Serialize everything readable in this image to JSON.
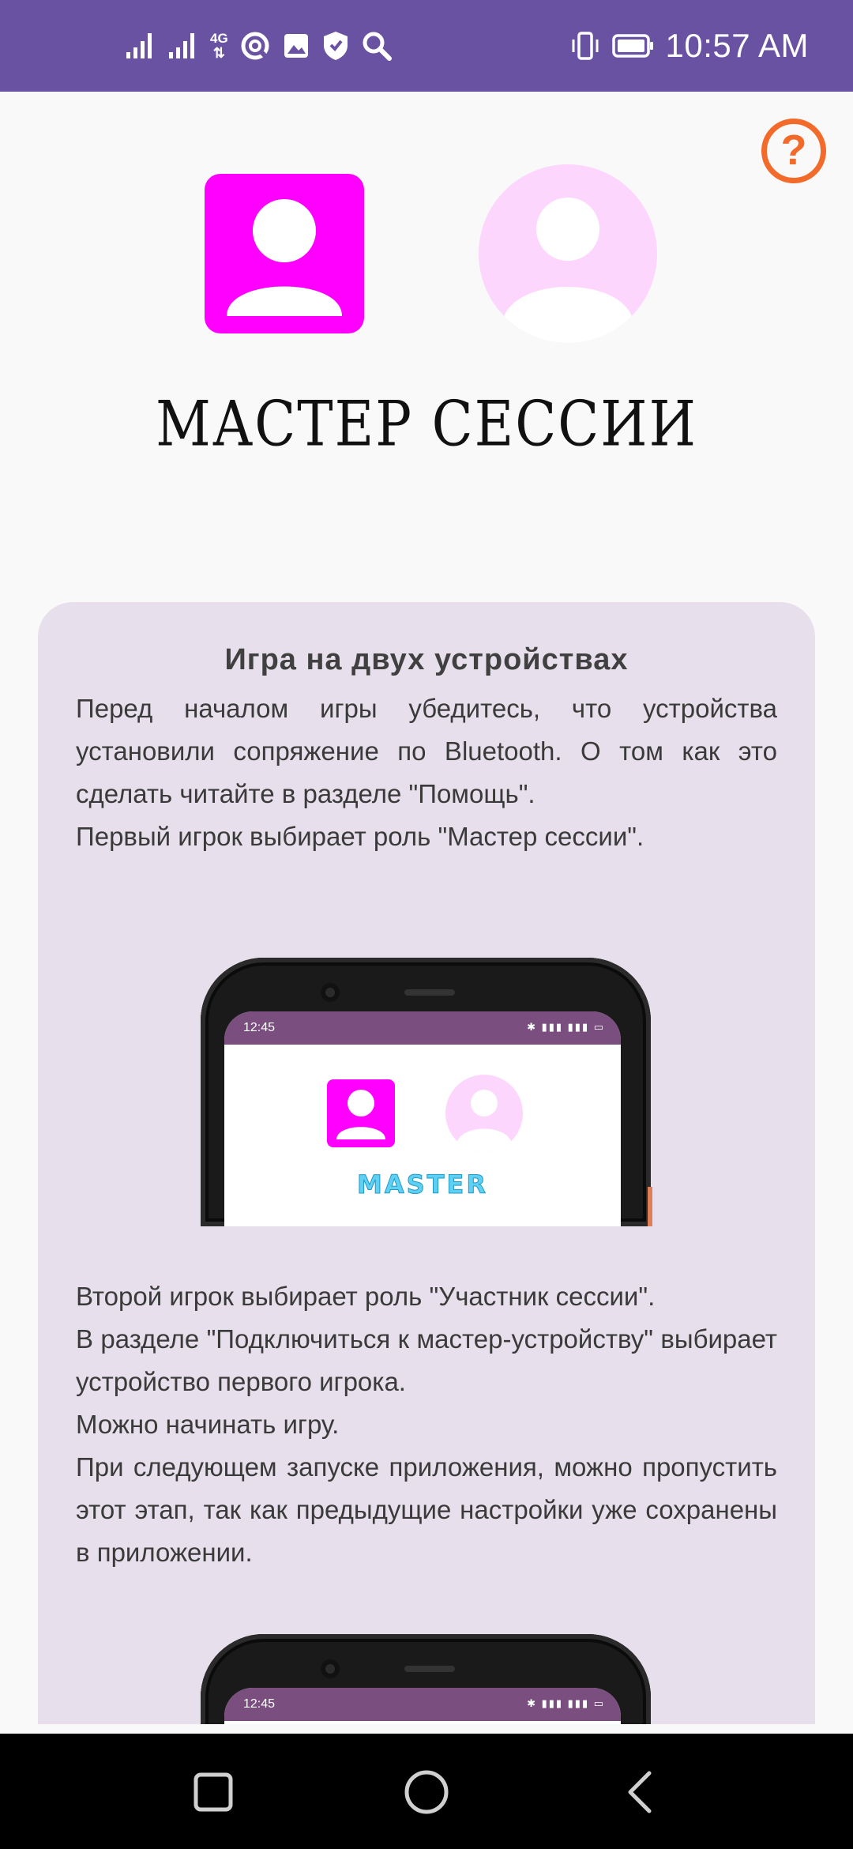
{
  "status_bar": {
    "time": "10:57 AM",
    "network_label": "4G",
    "icons": [
      "signal-icon",
      "signal-icon",
      "network-4g-icon",
      "sync-icon",
      "image-icon",
      "shield-icon",
      "search-icon",
      "vibrate-icon",
      "battery-icon"
    ]
  },
  "help": {
    "label": "?",
    "icon": "help-circle-icon"
  },
  "roles": {
    "master_icon": "user-square-icon",
    "participant_icon": "user-circle-icon",
    "selected_title": "МАСТЕР СЕССИИ"
  },
  "card": {
    "title": "Игра на двух устройствах",
    "intro": "Перед началом игры убедитесь, что устройства установили сопряжение по Bluetooth. О том как это сделать читайте в разделе \"Помощь\".",
    "step1": "Первый игрок выбирает роль \"Мастер сессии\".",
    "step2": "Второй игрок выбирает роль \"Участник сессии\".",
    "step3": "В разделе \"Подключиться к мастер-устройству\" выбирает устройство первого игрока.",
    "step4": "Можно начинать игру.",
    "step5": "При следующем запуске приложения, можно пропустить этот этап, так как предыдущие настройки уже сохранены в приложении.",
    "illustration1": {
      "time": "12:45",
      "label": "MASTER"
    },
    "illustration2": {
      "time": "12:45"
    }
  },
  "colors": {
    "status_bar": "#6a52a3",
    "accent_magenta": "#ff00ff",
    "participant_pink": "#fdd6fd",
    "help_orange": "#f26b2a",
    "card_bg": "#e7dfeb"
  },
  "nav": {
    "recent_icon": "square-icon",
    "home_icon": "circle-icon",
    "back_icon": "back-chevron-icon"
  }
}
